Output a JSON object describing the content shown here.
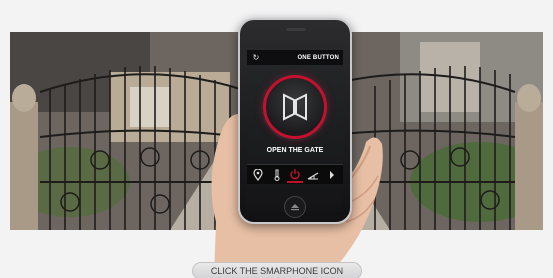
{
  "phone": {
    "header_title": "ONE BUTTON",
    "main_label": "OPEN THE GATE",
    "toolbar_icons": [
      "location-pin-icon",
      "thermometer-icon",
      "power-icon",
      "gate-icon",
      "next-arrow-icon"
    ],
    "accent_color": "#c8102e"
  },
  "cta": {
    "label": "CLICK THE SMARPHONE ICON"
  }
}
